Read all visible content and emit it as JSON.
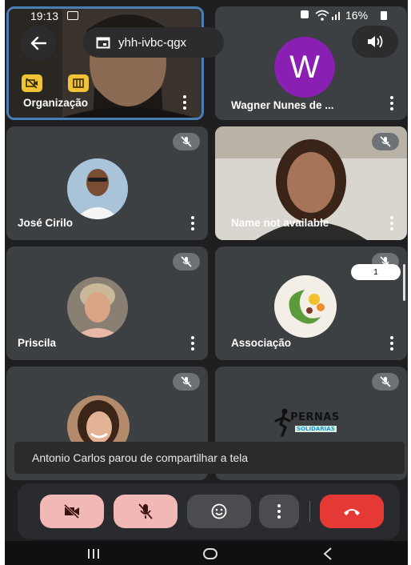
{
  "status_bar": {
    "time": "19:13",
    "battery": "16%"
  },
  "meeting": {
    "code": "yhh-ivbc-qgx"
  },
  "participants": [
    {
      "name": "Organização",
      "avatar": "video-feed"
    },
    {
      "name": "Wagner Nunes de ...",
      "avatar_letter": "W",
      "avatar_color": "#8a1fb3"
    },
    {
      "name": "José Cirilo",
      "avatar": "photo"
    },
    {
      "name": "Name not available",
      "avatar": "video-feed"
    },
    {
      "name": "Priscila",
      "avatar": "photo"
    },
    {
      "name": "Associação",
      "avatar": "logo"
    },
    {
      "name": "",
      "avatar": "photo"
    },
    {
      "name": "",
      "avatar": "logo",
      "logo_text_1": "PERNAS",
      "logo_text_2": "SOLIDARIAS"
    }
  ],
  "scroll_badge": {
    "count": "1"
  },
  "toast": {
    "message": "Antonio Carlos parou de compartilhar a tela"
  },
  "colors": {
    "background": "#1f1f21",
    "tile": "#3c4043",
    "off_button": "#f2b8b5",
    "end_call": "#e53935"
  },
  "controls": [
    "camera-off",
    "mic-off",
    "reactions",
    "more-options",
    "end-call"
  ]
}
